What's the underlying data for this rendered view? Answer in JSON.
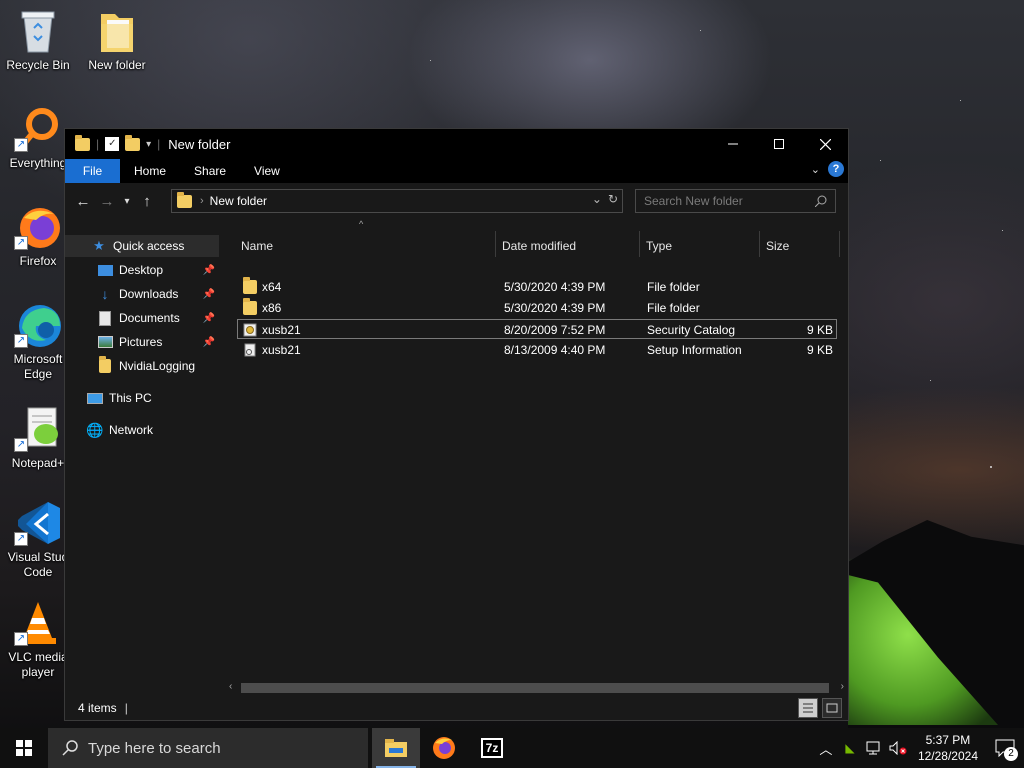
{
  "desktop": {
    "icons": [
      {
        "label": "Recycle Bin",
        "icon": "recycle-bin-icon"
      },
      {
        "label": "New folder",
        "icon": "folder-icon"
      },
      {
        "label": "Everything",
        "icon": "everything-search-icon"
      },
      {
        "label": "Firefox",
        "icon": "firefox-icon"
      },
      {
        "label": "Microsoft\nEdge",
        "icon": "edge-icon"
      },
      {
        "label": "Notepad+",
        "icon": "notepad-plus-plus-icon"
      },
      {
        "label": "Visual Stud\nCode",
        "icon": "vscode-icon"
      },
      {
        "label": "VLC media\nplayer",
        "icon": "vlc-icon"
      }
    ]
  },
  "window": {
    "title": "New folder",
    "ribbon_tabs": [
      "File",
      "Home",
      "Share",
      "View"
    ],
    "address": "New folder",
    "search_placeholder": "Search New folder",
    "nav": {
      "quick_access": "Quick access",
      "items": [
        {
          "label": "Desktop",
          "icon": "desktop-icon",
          "pinned": true
        },
        {
          "label": "Downloads",
          "icon": "downloads-icon",
          "pinned": true
        },
        {
          "label": "Documents",
          "icon": "documents-icon",
          "pinned": true
        },
        {
          "label": "Pictures",
          "icon": "pictures-icon",
          "pinned": true
        },
        {
          "label": "NvidiaLogging",
          "icon": "folder-icon",
          "pinned": false
        }
      ],
      "this_pc": "This PC",
      "network": "Network"
    },
    "columns": [
      "Name",
      "Date modified",
      "Type",
      "Size"
    ],
    "files": [
      {
        "name": "x64",
        "date": "5/30/2020 4:39 PM",
        "type": "File folder",
        "size": "",
        "icon": "folder-icon"
      },
      {
        "name": "x86",
        "date": "5/30/2020 4:39 PM",
        "type": "File folder",
        "size": "",
        "icon": "folder-icon"
      },
      {
        "name": "xusb21",
        "date": "8/20/2009 7:52 PM",
        "type": "Security Catalog",
        "size": "9 KB",
        "icon": "security-catalog-icon",
        "selected": true
      },
      {
        "name": "xusb21",
        "date": "8/13/2009 4:40 PM",
        "type": "Setup Information",
        "size": "9 KB",
        "icon": "setup-information-icon"
      }
    ],
    "status": "4 items"
  },
  "taskbar": {
    "search_placeholder": "Type here to search",
    "apps": [
      "file-explorer-icon",
      "firefox-icon",
      "7zip-icon"
    ],
    "time": "5:37 PM",
    "date": "12/28/2024",
    "notification_count": "2"
  }
}
